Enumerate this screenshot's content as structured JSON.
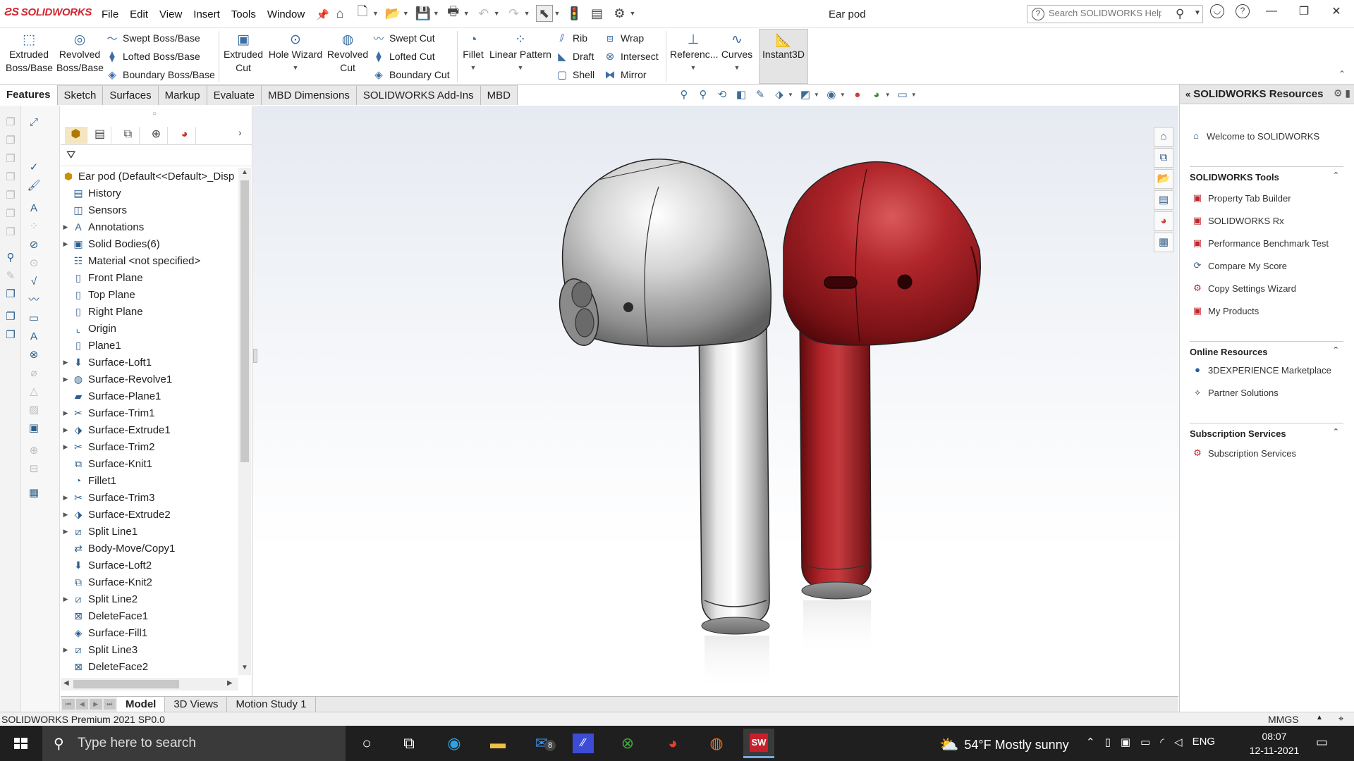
{
  "app": {
    "name": "SOLIDWORKS",
    "document_title": "Ear pod",
    "menus": [
      "File",
      "Edit",
      "View",
      "Insert",
      "Tools",
      "Window"
    ],
    "search_placeholder": "Search SOLIDWORKS Help"
  },
  "ribbon": {
    "extruded_boss": [
      "Extruded",
      "Boss/Base"
    ],
    "revolved_boss": [
      "Revolved",
      "Boss/Base"
    ],
    "swept_boss": "Swept Boss/Base",
    "lofted_boss": "Lofted Boss/Base",
    "boundary_boss": "Boundary Boss/Base",
    "extruded_cut": [
      "Extruded",
      "Cut"
    ],
    "hole_wizard": "Hole Wizard",
    "revolved_cut": [
      "Revolved",
      "Cut"
    ],
    "swept_cut": "Swept Cut",
    "lofted_cut": "Lofted Cut",
    "boundary_cut": "Boundary Cut",
    "fillet": "Fillet",
    "linear_pattern": "Linear Pattern",
    "rib": "Rib",
    "draft": "Draft",
    "shell": "Shell",
    "wrap": "Wrap",
    "intersect": "Intersect",
    "mirror": "Mirror",
    "reference": "Referenc...",
    "curves": "Curves",
    "instant3d": "Instant3D"
  },
  "tabs": [
    "Features",
    "Sketch",
    "Surfaces",
    "Markup",
    "Evaluate",
    "MBD Dimensions",
    "SOLIDWORKS Add-Ins",
    "MBD"
  ],
  "active_tab": "Features",
  "feature_tree": {
    "root": "Ear pod  (Default<<Default>_Disp",
    "items": [
      {
        "label": "History",
        "icon": "history-icon",
        "expandable": false
      },
      {
        "label": "Sensors",
        "icon": "sensors-icon",
        "expandable": false
      },
      {
        "label": "Annotations",
        "icon": "annotations-icon",
        "expandable": true
      },
      {
        "label": "Solid Bodies(6)",
        "icon": "solid-bodies-icon",
        "expandable": true
      },
      {
        "label": "Material <not specified>",
        "icon": "material-icon",
        "expandable": false
      },
      {
        "label": "Front Plane",
        "icon": "plane-icon",
        "expandable": false
      },
      {
        "label": "Top Plane",
        "icon": "plane-icon",
        "expandable": false
      },
      {
        "label": "Right Plane",
        "icon": "plane-icon",
        "expandable": false
      },
      {
        "label": "Origin",
        "icon": "origin-icon",
        "expandable": false
      },
      {
        "label": "Plane1",
        "icon": "plane-icon",
        "expandable": false
      },
      {
        "label": "Surface-Loft1",
        "icon": "surface-loft-icon",
        "expandable": true
      },
      {
        "label": "Surface-Revolve1",
        "icon": "surface-revolve-icon",
        "expandable": true
      },
      {
        "label": "Surface-Plane1",
        "icon": "surface-plane-icon",
        "expandable": false
      },
      {
        "label": "Surface-Trim1",
        "icon": "surface-trim-icon",
        "expandable": true
      },
      {
        "label": "Surface-Extrude1",
        "icon": "surface-extrude-icon",
        "expandable": true
      },
      {
        "label": "Surface-Trim2",
        "icon": "surface-trim-icon",
        "expandable": true
      },
      {
        "label": "Surface-Knit1",
        "icon": "surface-knit-icon",
        "expandable": false
      },
      {
        "label": "Fillet1",
        "icon": "fillet-icon",
        "expandable": false
      },
      {
        "label": "Surface-Trim3",
        "icon": "surface-trim-icon",
        "expandable": true
      },
      {
        "label": "Surface-Extrude2",
        "icon": "surface-extrude-icon",
        "expandable": true
      },
      {
        "label": "Split Line1",
        "icon": "split-line-icon",
        "expandable": true
      },
      {
        "label": "Body-Move/Copy1",
        "icon": "body-move-icon",
        "expandable": false
      },
      {
        "label": "Surface-Loft2",
        "icon": "surface-loft-icon",
        "expandable": false
      },
      {
        "label": "Surface-Knit2",
        "icon": "surface-knit-icon",
        "expandable": false
      },
      {
        "label": "Split Line2",
        "icon": "split-line-icon",
        "expandable": true
      },
      {
        "label": "DeleteFace1",
        "icon": "delete-face-icon",
        "expandable": false
      },
      {
        "label": "Surface-Fill1",
        "icon": "surface-fill-icon",
        "expandable": false
      },
      {
        "label": "Split Line3",
        "icon": "split-line-icon",
        "expandable": true
      },
      {
        "label": "DeleteFace2",
        "icon": "delete-face-icon",
        "expandable": false
      }
    ]
  },
  "resources": {
    "title": "SOLIDWORKS Resources",
    "welcome": "Welcome to SOLIDWORKS",
    "tools_header": "SOLIDWORKS Tools",
    "tools": [
      "Property Tab Builder",
      "SOLIDWORKS Rx",
      "Performance Benchmark Test",
      "Compare My Score",
      "Copy Settings Wizard",
      "My Products"
    ],
    "online_header": "Online Resources",
    "online": [
      "3DEXPERIENCE Marketplace",
      "Partner Solutions"
    ],
    "subscription_header": "Subscription Services",
    "subscription": [
      "Subscription Services"
    ]
  },
  "model_tabs": [
    "Model",
    "3D Views",
    "Motion Study 1"
  ],
  "active_model_tab": "Model",
  "status": {
    "version": "SOLIDWORKS Premium 2021 SP0.0",
    "units": "MMGS"
  },
  "taskbar": {
    "search_placeholder": "Type here to search",
    "mail_badge": "8",
    "weather": "54°F  Mostly sunny",
    "language": "ENG",
    "time": "08:07",
    "date": "12-11-2021"
  },
  "colors": {
    "brand_red": "#d22630",
    "earpod_red": "#a8191c",
    "earpod_silver": "#c8c8c8",
    "taskbar": "#1f1f1f"
  }
}
